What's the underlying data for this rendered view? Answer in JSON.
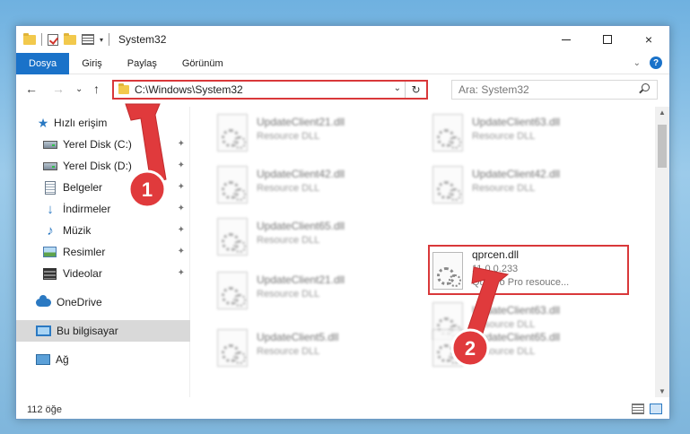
{
  "window": {
    "title": "System32",
    "controls": {
      "minimize": "minimize-icon",
      "maximize": "maximize-icon",
      "close": "×"
    }
  },
  "ribbon": {
    "tabs": [
      "Dosya",
      "Giriş",
      "Paylaş",
      "Görünüm"
    ],
    "help_label": "?",
    "collapse_label": "⌄"
  },
  "nav": {
    "back": "←",
    "forward": "→",
    "recent": "⌄",
    "up": "↑",
    "address": "C:\\Windows\\System32",
    "address_dropdown": "⌄",
    "refresh": "↻",
    "search_placeholder": "Ara: System32"
  },
  "sidebar": {
    "items": [
      {
        "label": "Hızlı erişim",
        "icon": "star-icon",
        "pinned": false
      },
      {
        "label": "Yerel Disk (C:)",
        "icon": "disk-icon",
        "pinned": true
      },
      {
        "label": "Yerel Disk (D:)",
        "icon": "disk-icon",
        "pinned": true
      },
      {
        "label": "Belgeler",
        "icon": "document-icon",
        "pinned": true
      },
      {
        "label": "İndirmeler",
        "icon": "download-icon",
        "pinned": true
      },
      {
        "label": "Müzik",
        "icon": "music-icon",
        "pinned": true
      },
      {
        "label": "Resimler",
        "icon": "pictures-icon",
        "pinned": true
      },
      {
        "label": "Videolar",
        "icon": "videos-icon",
        "pinned": true
      },
      {
        "label": "OneDrive",
        "icon": "cloud-icon",
        "pinned": false
      },
      {
        "label": "Bu bilgisayar",
        "icon": "computer-icon",
        "pinned": false,
        "selected": true
      },
      {
        "label": "Ağ",
        "icon": "network-icon",
        "pinned": false
      }
    ],
    "pin_glyph": "📌"
  },
  "files": [
    {
      "name": "UpdateClient21.dll",
      "desc": "Resource DLL",
      "blurred": true
    },
    {
      "name": "UpdateClient63.dll",
      "desc": "Resource DLL",
      "blurred": true
    },
    {
      "name": "UpdateClient42.dll",
      "desc": "Resource DLL",
      "blurred": true
    },
    {
      "name": "UpdateClient42.dll",
      "desc": "Resource DLL",
      "blurred": true
    },
    {
      "name": "UpdateClient65.dll",
      "desc": "Resource DLL",
      "blurred": true
    },
    {
      "name": "qprcen.dll",
      "version": "11.0.0.233",
      "desc": "Quattro Pro resouce...",
      "blurred": false
    },
    {
      "name": "UpdateClient21.dll",
      "desc": "Resource DLL",
      "blurred": true
    },
    {
      "name": "UpdateClient63.dll",
      "desc": "Resource DLL",
      "blurred": true
    },
    {
      "name": "UpdateClient5.dll",
      "desc": "Resource DLL",
      "blurred": true
    },
    {
      "name": "UpdateClient65.dll",
      "desc": "Resource DLL",
      "blurred": true
    }
  ],
  "status": {
    "count": "112 öğe"
  },
  "annotations": {
    "step1": "1",
    "step2": "2",
    "color": "#d9383a"
  },
  "scroll": {
    "up": "▲",
    "down": "▼"
  }
}
